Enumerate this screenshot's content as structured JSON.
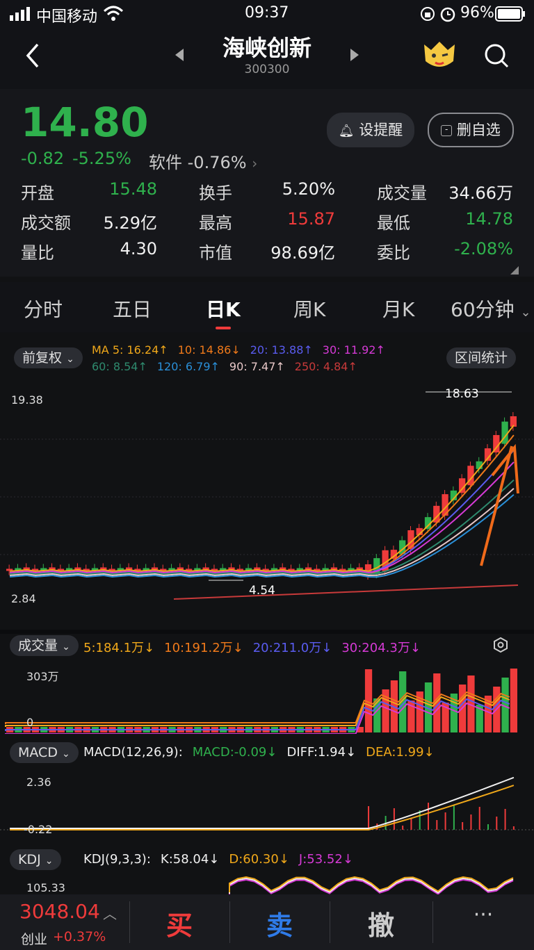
{
  "status_bar": {
    "carrier": "中国移动",
    "time": "09:37",
    "battery": "96%"
  },
  "header": {
    "stock_name": "海峡创新",
    "stock_code": "300300"
  },
  "quote": {
    "price": "14.80",
    "change": "-0.82",
    "change_pct": "-5.25%",
    "sector_name": "软件",
    "sector_change": "-0.76%",
    "alert_button": "设提醒",
    "watch_button": "删自选",
    "stats": [
      {
        "label": "开盘",
        "value": "15.48",
        "color": "green"
      },
      {
        "label": "换手",
        "value": "5.20%",
        "color": "white"
      },
      {
        "label": "成交量",
        "value": "34.66万",
        "color": "white"
      },
      {
        "label": "成交额",
        "value": "5.29亿",
        "color": "white"
      },
      {
        "label": "最高",
        "value": "15.87",
        "color": "red"
      },
      {
        "label": "最低",
        "value": "14.78",
        "color": "green"
      },
      {
        "label": "量比",
        "value": "4.30",
        "color": "white"
      },
      {
        "label": "市值",
        "value": "98.69亿",
        "color": "white"
      },
      {
        "label": "委比",
        "value": "-2.08%",
        "color": "green"
      }
    ]
  },
  "tabs": [
    "分时",
    "五日",
    "日K",
    "周K",
    "月K",
    "60分钟"
  ],
  "kline": {
    "adjust_label": "前复权",
    "range_stats_label": "区间统计",
    "ma_row1": [
      {
        "text": "MA 5: 16.24↑",
        "color": "#f0a81a"
      },
      {
        "text": "10: 14.86↓",
        "color": "#f07a1a"
      },
      {
        "text": "20: 13.88↑",
        "color": "#5a5cf0"
      },
      {
        "text": "30: 11.92↑",
        "color": "#d63ad6"
      }
    ],
    "ma_row2": [
      {
        "text": "60: 8.54↑",
        "color": "#2e8a6e"
      },
      {
        "text": "120: 6.79↑",
        "color": "#2a8fd8"
      },
      {
        "text": "90: 7.47↑",
        "color": "#e8c8c8"
      },
      {
        "text": "250: 4.84↑",
        "color": "#c83a3a"
      }
    ],
    "y_high": "19.38",
    "y_low": "2.84",
    "max_label": "18.63",
    "min_label": "4.54"
  },
  "volume": {
    "label": "成交量",
    "items": [
      {
        "text": "5:184.1万↓",
        "color": "#f0a81a"
      },
      {
        "text": "10:191.2万↓",
        "color": "#f07a1a"
      },
      {
        "text": "20:211.0万↓",
        "color": "#5a5cf0"
      },
      {
        "text": "30:204.3万↓",
        "color": "#d63ad6"
      }
    ],
    "y_top": "303万",
    "y_zero": "0"
  },
  "macd": {
    "label": "MACD",
    "items": [
      {
        "text": "MACD(12,26,9):",
        "color": "#f1f1f1"
      },
      {
        "text": "MACD:-0.09↓",
        "color": "#2fb14d"
      },
      {
        "text": "DIFF:1.94↓",
        "color": "#f1f1f1"
      },
      {
        "text": "DEA:1.99↓",
        "color": "#f0a81a"
      }
    ],
    "y_top": "2.36",
    "y_bottom": "-0.22"
  },
  "kdj": {
    "label": "KDJ",
    "items": [
      {
        "text": "KDJ(9,3,3):",
        "color": "#f1f1f1"
      },
      {
        "text": "K:58.04↓",
        "color": "#f1f1f1"
      },
      {
        "text": "D:60.30↓",
        "color": "#f0a81a"
      },
      {
        "text": "J:53.52↓",
        "color": "#d63ad6"
      }
    ],
    "y_top": "105.33"
  },
  "bottom_bar": {
    "index_value": "3048.04",
    "index_name": "创业",
    "index_change": "+0.37%",
    "buy": "买",
    "sell": "卖",
    "cancel": "撤",
    "more": "···"
  }
}
